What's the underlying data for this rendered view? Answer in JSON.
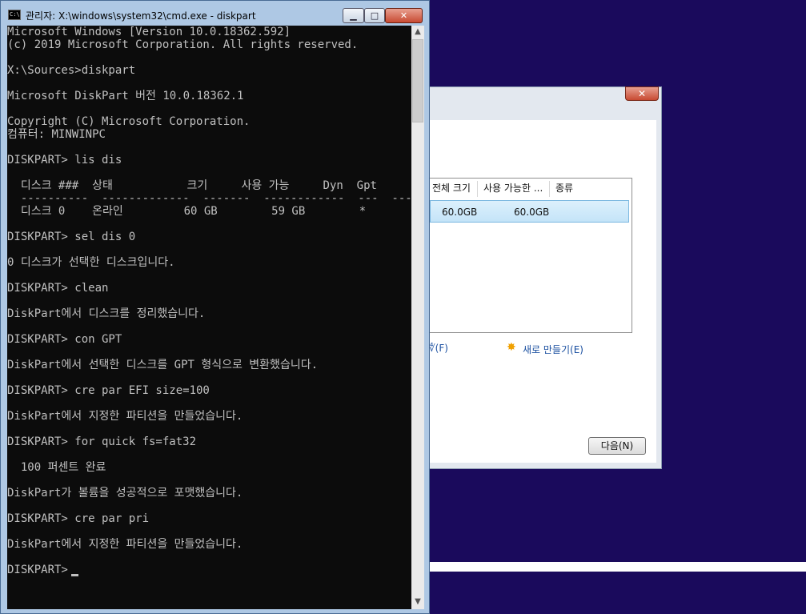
{
  "cmd": {
    "title": "관리자: X:\\windows\\system32\\cmd.exe - diskpart",
    "icon_label": "C:\\",
    "buttons": {
      "minimize": "▁",
      "maximize": "□",
      "close": "✕"
    },
    "lines": [
      "Microsoft Windows [Version 10.0.18362.592]",
      "(c) 2019 Microsoft Corporation. All rights reserved.",
      "X:\\Sources>diskpart",
      "Microsoft DiskPart 버전 10.0.18362.1",
      "Copyright (C) Microsoft Corporation.",
      "컴퓨터: MINWINPC",
      "DISKPART> lis dis",
      "  디스크 ###  상태           크기     사용 가능     Dyn  Gpt",
      "  ----------  -------------  -------  ------------  ---  ---",
      "  디스크 0    온라인         60 GB        59 GB        *",
      "DISKPART> sel dis 0",
      "0 디스크가 선택한 디스크입니다.",
      "DISKPART> clean",
      "DiskPart에서 디스크를 정리했습니다.",
      "DISKPART> con GPT",
      "DiskPart에서 선택한 디스크를 GPT 형식으로 변환했습니다.",
      "DISKPART> cre par EFI size=100",
      "DiskPart에서 지정한 파티션을 만들었습니다.",
      "DISKPART> for quick fs=fat32",
      "  100 퍼센트 완료",
      "DiskPart가 볼륨을 성공적으로 포맷했습니다.",
      "DISKPART> cre par pri",
      "DiskPart에서 지정한 파티션을 만들었습니다.",
      "DISKPART> "
    ],
    "scroll": {
      "up": "▲",
      "down": "▼"
    }
  },
  "setup": {
    "close_label": "✕",
    "columns": [
      "전체 크기",
      "사용 가능한 ...",
      "종류"
    ],
    "row": {
      "total": "60.0GB",
      "free": "60.0GB",
      "type": ""
    },
    "link_partial": "∜(F)",
    "new_link": "새로 만들기(E)",
    "next_button": "다음(N)"
  },
  "colors": {
    "desktop": "#1a0a5c",
    "console_bg": "#0c0c0c",
    "console_fg": "#c0c0c0",
    "selection": "#c4e4f8"
  }
}
